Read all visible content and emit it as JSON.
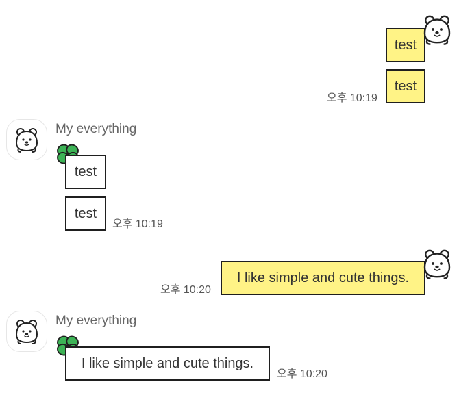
{
  "conversation": {
    "messages": [
      {
        "direction": "outgoing",
        "text": "test",
        "time": ""
      },
      {
        "direction": "outgoing",
        "text": "test",
        "time": "오후 10:19"
      },
      {
        "direction": "incoming",
        "sender": "My everything",
        "text": "test",
        "time": ""
      },
      {
        "direction": "incoming",
        "text": "test",
        "time": "오후 10:19"
      },
      {
        "direction": "outgoing",
        "text": "I like simple and cute things.",
        "time": "오후 10:20"
      },
      {
        "direction": "incoming",
        "sender": "My everything",
        "text": "I like simple and cute things.",
        "time": "오후 10:20"
      }
    ]
  },
  "theme": {
    "outgoing_bubble_color": "#fff386",
    "incoming_bubble_color": "#ffffff",
    "bubble_border_color": "#1f1f1f",
    "clover_color": "#3db356",
    "text_color": "#333333",
    "timestamp_color": "#555555"
  },
  "icons": {
    "outgoing_decoration": "bear-peek-icon",
    "incoming_decoration": "clover-icon",
    "avatar": "bear-avatar-icon"
  }
}
